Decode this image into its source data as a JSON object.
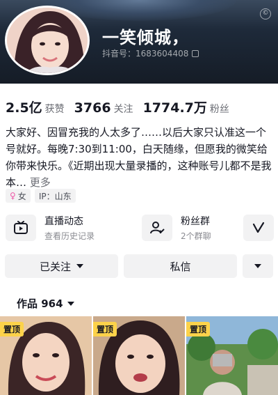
{
  "profile": {
    "nickname": "一笑倾城，",
    "id_line": "抖音号：1683604408",
    "copyright_mark": "©"
  },
  "stats": [
    {
      "num": "2.5亿",
      "label": "获赞"
    },
    {
      "num": "3766",
      "label": "关注"
    },
    {
      "num": "1774.7万",
      "label": "粉丝"
    }
  ],
  "bio": {
    "text": "大家好、因冒充我的人太多了……以后大家只认准这一个号就好。每晚7:30到11:00，白天随缘，但愿我的微笑给你带来快乐。《近期出现大量录播的，这种账号儿都不是我本…",
    "more": "更多"
  },
  "tags": {
    "gender_icon": "♀",
    "gender": "女",
    "ip": "IP：山东"
  },
  "cards": {
    "live": {
      "title": "直播动态",
      "sub": "查看历史记录",
      "icon": "tv-icon"
    },
    "fans": {
      "title": "粉丝群",
      "sub": "2个群聊",
      "icon": "users-icon"
    },
    "third": {
      "icon": "v-check-icon"
    }
  },
  "buttons": {
    "followed": "已关注",
    "message": "私信"
  },
  "works": {
    "label": "作品 964"
  },
  "thumbs": [
    {
      "pin": "置顶"
    },
    {
      "pin": "置顶"
    },
    {
      "pin": "置顶"
    }
  ],
  "colors": {
    "pin": "#fcd24a",
    "female": "#ee5aa8",
    "button_bg": "#f2f2f3"
  }
}
